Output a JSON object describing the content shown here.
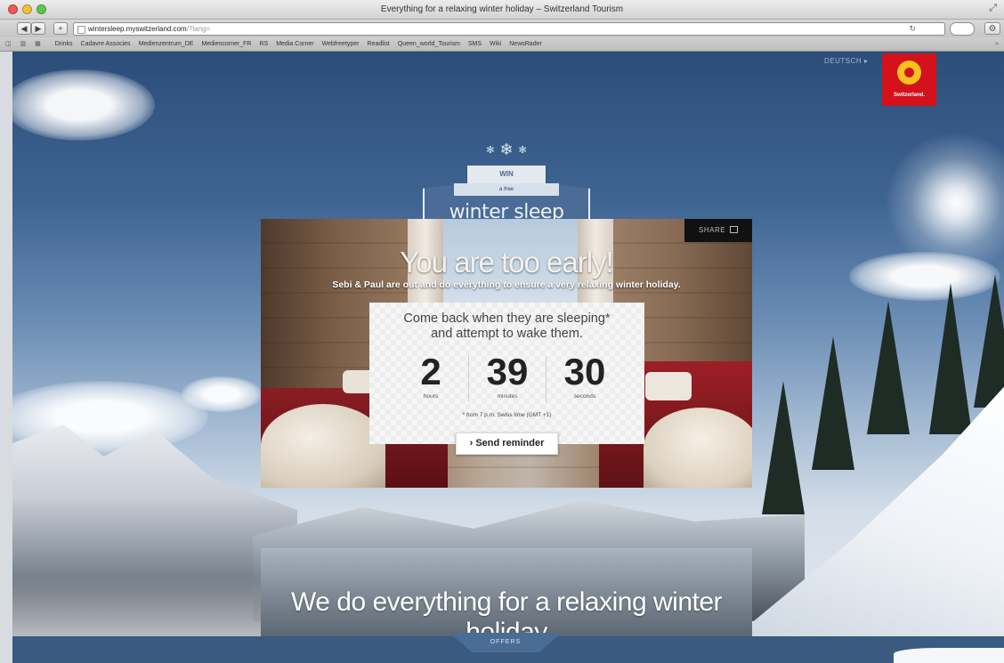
{
  "browser": {
    "window_title": "Everything for a relaxing winter holiday – Switzerland Tourism",
    "url_host": "wintersleep.myswitzerland.com",
    "url_path": "/?lang=",
    "bookmarks": [
      "Drinks",
      "Cadavre Associes",
      "Medienzentrum_DE",
      "Mediencorner_FR",
      "RS",
      "Media Corner",
      "Webfreetyper",
      "Readlist",
      "Queen_world_Tourism",
      "SMS",
      "Wiki",
      "NewsRader"
    ]
  },
  "page": {
    "top_link": "DEUTSCH ▸",
    "logo_text": "Switzerland."
  },
  "badge": {
    "win": "WIN",
    "ribbon": "a free",
    "title": "winter sleep"
  },
  "hero": {
    "share": "SHARE",
    "headline": "You are too early!",
    "subline": "Sebi & Paul are out and do everything to ensure a very relaxing winter holiday.",
    "countdown": {
      "message_line1": "Come back when they are sleeping*",
      "message_line2": "and attempt to wake them.",
      "hours": "2",
      "hours_label": "hours",
      "minutes": "39",
      "minutes_label": "minutes",
      "seconds": "30",
      "seconds_label": "seconds",
      "note": "* from 7 p.m. Swiss time (GMT +1)",
      "button": "› Send reminder"
    }
  },
  "lower": {
    "headline": "We do everything for a relaxing winter holiday"
  },
  "footer": {
    "offers": "OFFERS"
  },
  "colors": {
    "brand_red": "#d3121b",
    "badge_blue": "#4a6c96",
    "bar_blue": "#3a5a80"
  }
}
